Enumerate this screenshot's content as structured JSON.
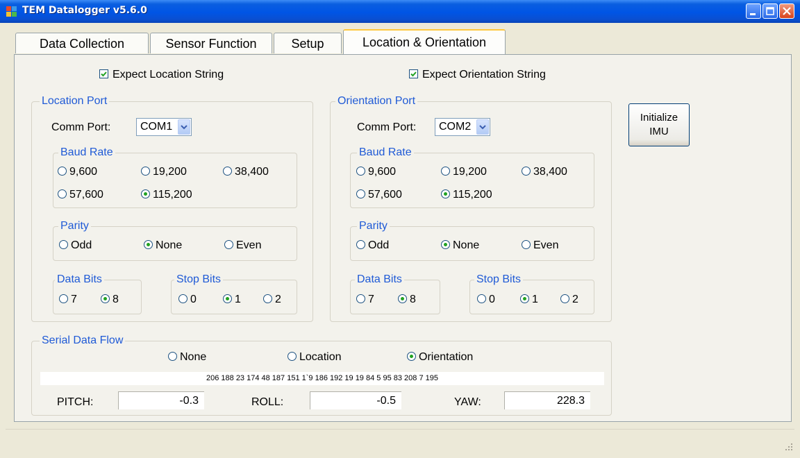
{
  "window": {
    "title": "TEM Datalogger v5.6.0",
    "title_bar_color": "#0055e5"
  },
  "tabs": [
    {
      "label": "Data Collection"
    },
    {
      "label": "Sensor Function"
    },
    {
      "label": "Setup"
    },
    {
      "label": "Location & Orientation",
      "selected": true
    }
  ],
  "expect": {
    "location_label": "Expect Location String",
    "location_checked": true,
    "orientation_label": "Expect Orientation String",
    "orientation_checked": true
  },
  "location_port": {
    "title": "Location Port",
    "comm_label": "Comm Port:",
    "comm_value": "COM1",
    "baud": {
      "title": "Baud Rate",
      "options": [
        "9,600",
        "19,200",
        "38,400",
        "57,600",
        "115,200"
      ],
      "selected": "115,200"
    },
    "parity": {
      "title": "Parity",
      "options": [
        "Odd",
        "None",
        "Even"
      ],
      "selected": "None"
    },
    "data_bits": {
      "title": "Data Bits",
      "options": [
        "7",
        "8"
      ],
      "selected": "8"
    },
    "stop_bits": {
      "title": "Stop Bits",
      "options": [
        "0",
        "1",
        "2"
      ],
      "selected": "1"
    }
  },
  "orientation_port": {
    "title": "Orientation Port",
    "comm_label": "Comm Port:",
    "comm_value": "COM2",
    "baud": {
      "title": "Baud Rate",
      "options": [
        "9,600",
        "19,200",
        "38,400",
        "57,600",
        "115,200"
      ],
      "selected": "115,200"
    },
    "parity": {
      "title": "Parity",
      "options": [
        "Odd",
        "None",
        "Even"
      ],
      "selected": "None"
    },
    "data_bits": {
      "title": "Data Bits",
      "options": [
        "7",
        "8"
      ],
      "selected": "8"
    },
    "stop_bits": {
      "title": "Stop Bits",
      "options": [
        "0",
        "1",
        "2"
      ],
      "selected": "1"
    }
  },
  "init_button": {
    "line1": "Initialize",
    "line2": "IMU"
  },
  "serial_flow": {
    "title": "Serial Data Flow",
    "options": [
      "None",
      "Location",
      "Orientation"
    ],
    "selected": "Orientation",
    "data_stream": "206 188 23 174 48 187 151 1`9 186 192 19 19 84 5 95 83 208 7 195",
    "pitch_label": "PITCH:",
    "pitch_value": "-0.3",
    "roll_label": "ROLL:",
    "roll_value": "-0.5",
    "yaw_label": "YAW:",
    "yaw_value": "228.3"
  },
  "colors": {
    "group_title": "#1f5ad6",
    "radio_dot": "#21a121",
    "active_tab_accent": "#ffc83c"
  }
}
